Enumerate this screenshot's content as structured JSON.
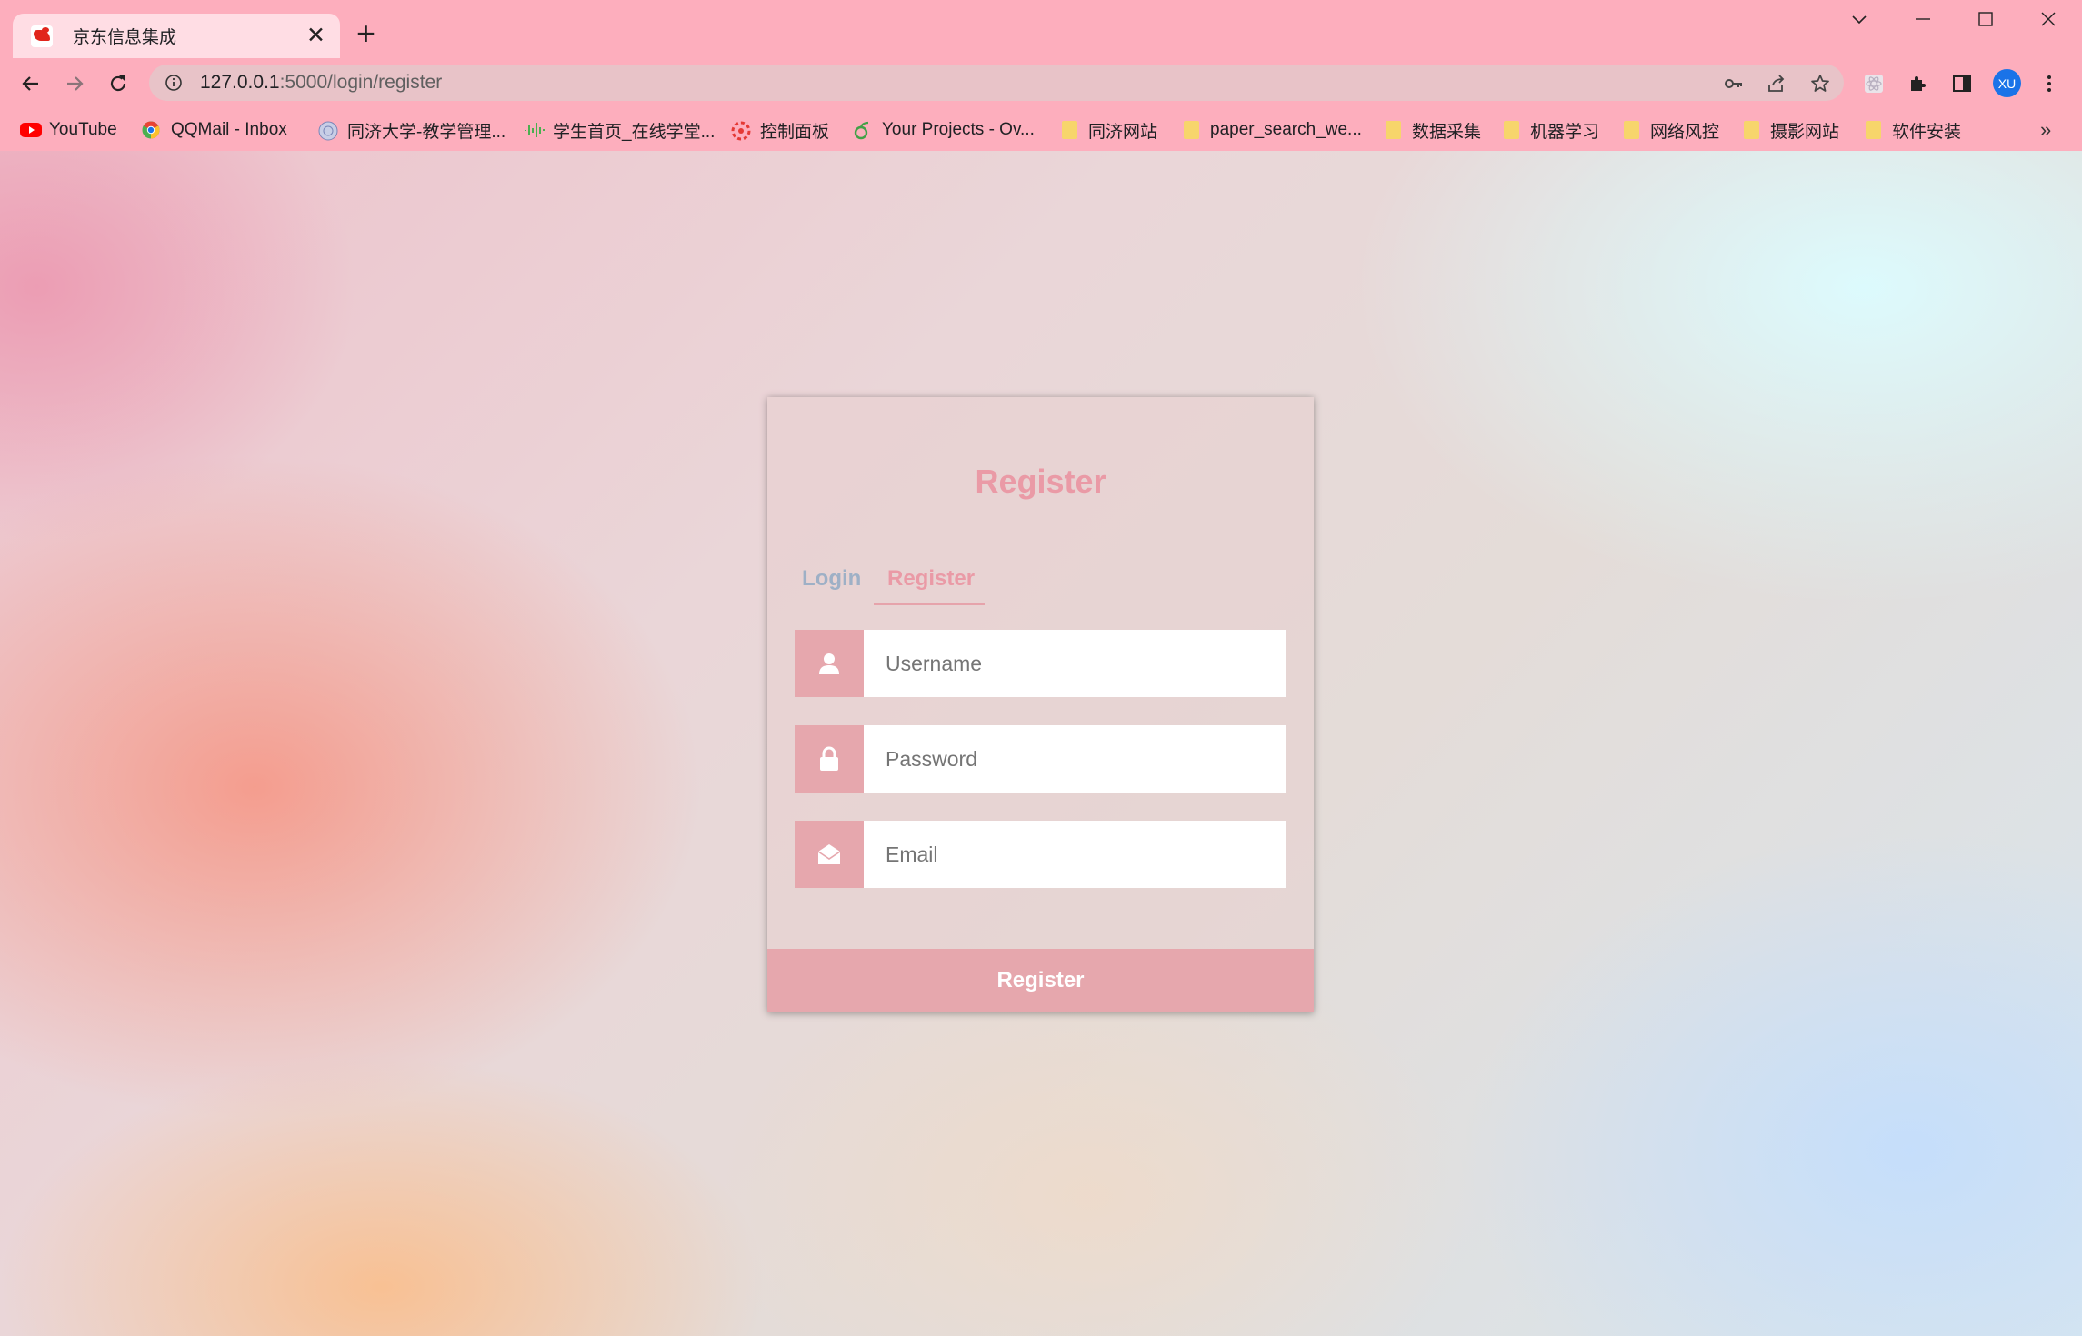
{
  "browser": {
    "tab": {
      "title": "京东信息集成",
      "close_glyph": "✕"
    },
    "new_tab_glyph": "+",
    "window_controls": {
      "tab_search": "⌵",
      "minimize": "—",
      "maximize": "☐",
      "close": "✕"
    },
    "url": {
      "host": "127.0.0.1",
      "path": ":5000/login/register"
    },
    "profile_initials": "XU",
    "bookmarks": [
      {
        "label": "YouTube",
        "icon": "youtube-icon"
      },
      {
        "label": "QQMail - Inbox",
        "icon": "chrome-icon"
      },
      {
        "label": "同济大学-教学管理...",
        "icon": "university-seal-icon"
      },
      {
        "label": "学生首页_在线学堂...",
        "icon": "waveform-icon"
      },
      {
        "label": "控制面板",
        "icon": "red-gear-icon"
      },
      {
        "label": "Your Projects - Ov...",
        "icon": "leaf-icon"
      },
      {
        "label": "同济网站",
        "icon": "folder-icon"
      },
      {
        "label": "paper_search_we...",
        "icon": "folder-icon"
      },
      {
        "label": "数据采集",
        "icon": "folder-icon"
      },
      {
        "label": "机器学习",
        "icon": "folder-icon"
      },
      {
        "label": "网络风控",
        "icon": "folder-icon"
      },
      {
        "label": "摄影网站",
        "icon": "folder-icon"
      },
      {
        "label": "软件安装",
        "icon": "folder-icon"
      }
    ],
    "bookmarks_overflow": "»"
  },
  "form": {
    "title": "Register",
    "tabs": [
      {
        "label": "Login",
        "active": false
      },
      {
        "label": "Register",
        "active": true
      }
    ],
    "fields": {
      "username": {
        "placeholder": "Username",
        "icon": "user-icon"
      },
      "password": {
        "placeholder": "Password",
        "icon": "lock-icon"
      },
      "email": {
        "placeholder": "Email",
        "icon": "envelope-icon"
      }
    },
    "submit_label": "Register"
  },
  "colors": {
    "chrome": "#fdaebd",
    "accent": "#e6a7ad",
    "title": "#ea9aa6",
    "inactive_tab": "#9eb0c6"
  }
}
